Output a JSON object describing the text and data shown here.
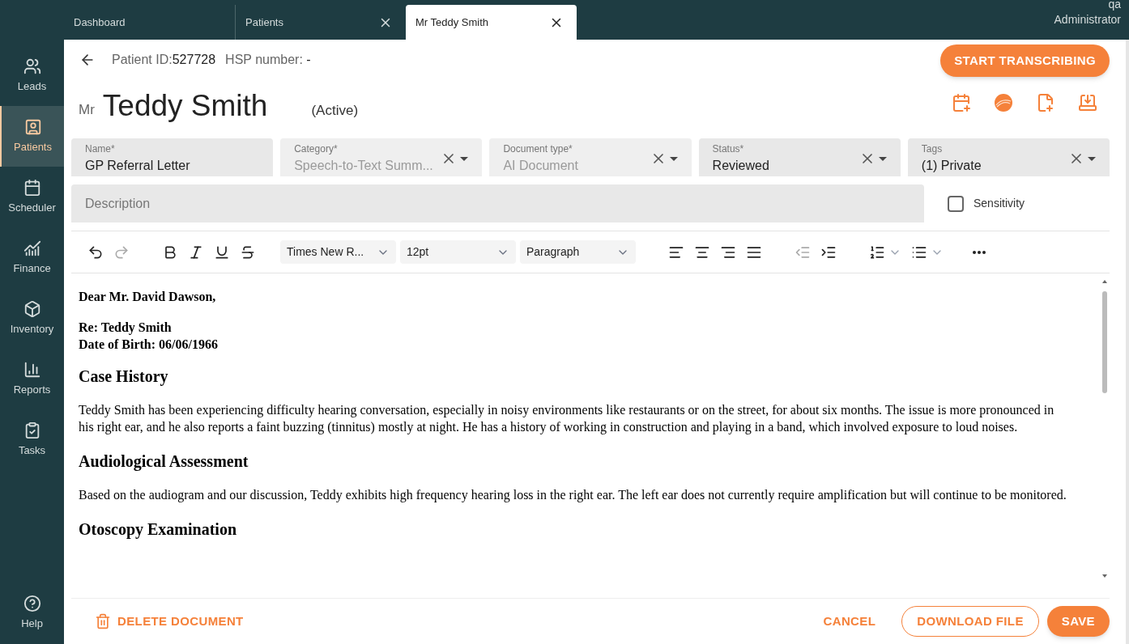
{
  "tabs": [
    {
      "label": "Dashboard",
      "selected": false,
      "closable": false
    },
    {
      "label": "Patients",
      "selected": false,
      "closable": true
    },
    {
      "label": "Mr Teddy Smith",
      "selected": true,
      "closable": true
    }
  ],
  "user": {
    "name": "qa",
    "role": "Administrator"
  },
  "sidebar": {
    "items": [
      {
        "label": "Leads",
        "selected": false
      },
      {
        "label": "Patients",
        "selected": true
      },
      {
        "label": "Scheduler",
        "selected": false
      },
      {
        "label": "Finance",
        "selected": false
      },
      {
        "label": "Inventory",
        "selected": false
      },
      {
        "label": "Reports",
        "selected": false
      },
      {
        "label": "Tasks",
        "selected": false
      }
    ],
    "help": "Help"
  },
  "header": {
    "patient_id_label": "Patient ID:",
    "patient_id": "527728",
    "hsp_label": "HSP number:",
    "hsp": "-",
    "title_prefix": "Mr",
    "name": "Teddy Smith",
    "status": "(Active)",
    "primary_action": "START TRANSCRIBING"
  },
  "fields": [
    {
      "label": "Name*",
      "value": "GP Referral Letter",
      "disabled": false,
      "clearable": false
    },
    {
      "label": "Category*",
      "value": "Speech-to-Text Summ...",
      "disabled": true,
      "clearable": true
    },
    {
      "label": "Document type*",
      "value": "AI Document",
      "disabled": true,
      "clearable": true
    },
    {
      "label": "Status*",
      "value": "Reviewed",
      "disabled": false,
      "clearable": true
    },
    {
      "label": "Tags",
      "value": "(1) Private",
      "disabled": false,
      "clearable": true
    }
  ],
  "description": {
    "placeholder": "Description"
  },
  "sensitivity": {
    "label": "Sensitivity",
    "checked": false
  },
  "toolbar": {
    "font": "Times New R...",
    "size": "12pt",
    "block": "Paragraph",
    "buttons": [
      {
        "kind": "undo",
        "disabled": false
      },
      {
        "kind": "redo",
        "disabled": true
      },
      {
        "kind": "bold",
        "disabled": false
      },
      {
        "kind": "italic",
        "disabled": false
      },
      {
        "kind": "underline",
        "disabled": false
      },
      {
        "kind": "strike",
        "disabled": false
      },
      {
        "kind": "align-left",
        "disabled": false
      },
      {
        "kind": "align-center",
        "disabled": false
      },
      {
        "kind": "align-right",
        "disabled": false
      },
      {
        "kind": "justify",
        "disabled": false
      },
      {
        "kind": "outdent",
        "disabled": true
      },
      {
        "kind": "indent",
        "disabled": false
      },
      {
        "kind": "numbered",
        "disabled": false
      },
      {
        "kind": "bullets",
        "disabled": false
      },
      {
        "kind": "more",
        "disabled": false
      }
    ]
  },
  "document": [
    {
      "kind": "bold",
      "lines": [
        "Dear Mr. David Dawson,"
      ]
    },
    {
      "kind": "bold",
      "lines": [
        "Re: Teddy Smith",
        "Date of Birth: 06/06/1966"
      ]
    },
    {
      "kind": "heading",
      "text": "Case History"
    },
    {
      "kind": "paragraph",
      "text": "Teddy Smith has been experiencing difficulty hearing conversation, especially in noisy environments like restaurants or on the street, for about six months. The issue is more pronounced in his right ear, and he also reports a faint buzzing (tinnitus) mostly at night. He has a history of working in construction and playing in a band, which involved exposure to loud noises."
    },
    {
      "kind": "heading",
      "text": "Audiological Assessment"
    },
    {
      "kind": "paragraph",
      "text": "Based on the audiogram and our discussion, Teddy exhibits high frequency hearing loss in the right ear. The left ear does not currently require amplification but will continue to be monitored."
    },
    {
      "kind": "heading",
      "text": "Otoscopy Examination"
    }
  ],
  "footer": {
    "delete": "DELETE DOCUMENT",
    "cancel": "CANCEL",
    "download": "DOWNLOAD FILE",
    "save": "SAVE"
  }
}
